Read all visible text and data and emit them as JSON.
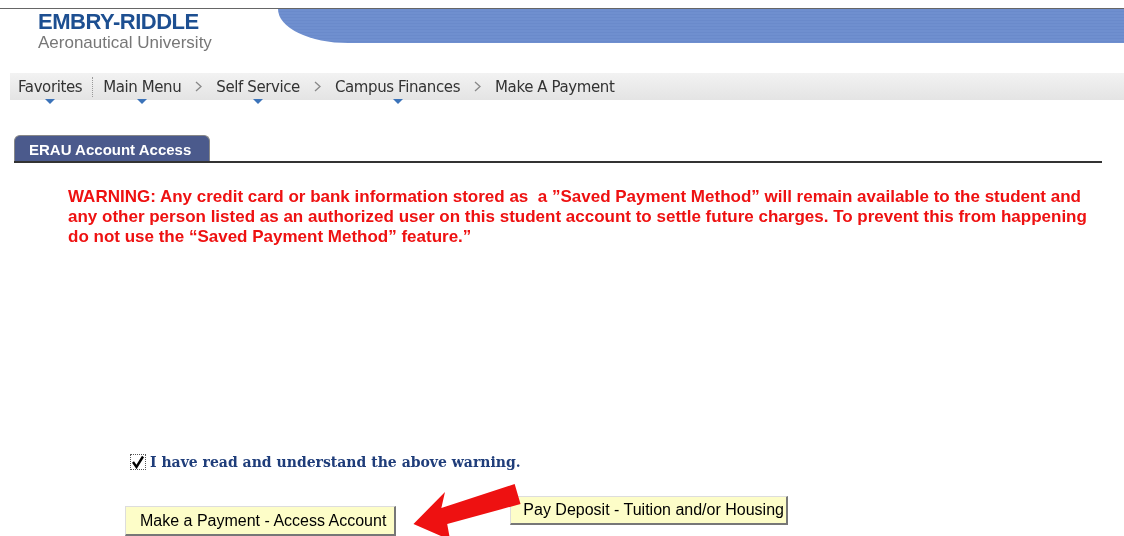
{
  "logo": {
    "name": "EMBRY-RIDDLE",
    "subtitle": "Aeronautical University"
  },
  "breadcrumb": [
    {
      "label": "Favorites",
      "dropdown": true
    },
    {
      "label": "Main Menu",
      "dropdown": true
    },
    {
      "label": "Self Service",
      "dropdown": true
    },
    {
      "label": "Campus Finances",
      "dropdown": true
    },
    {
      "label": "Make A Payment",
      "dropdown": false
    }
  ],
  "tabs": [
    {
      "label": "ERAU Account Access",
      "selected": true
    }
  ],
  "warning": "WARNING: Any credit card or bank information stored as  a ”Saved Payment Method” will remain available to the student and any other person listed as an authorized user on this student account to settle future charges. To prevent this from happening do not use the “Saved Payment Method” feature.”",
  "acknowledge": {
    "label": "I have read and understand the above warning.",
    "checked": true
  },
  "buttons": [
    "Make a Payment - Access Account",
    "Pay Deposit - Tuition and/or Housing"
  ]
}
